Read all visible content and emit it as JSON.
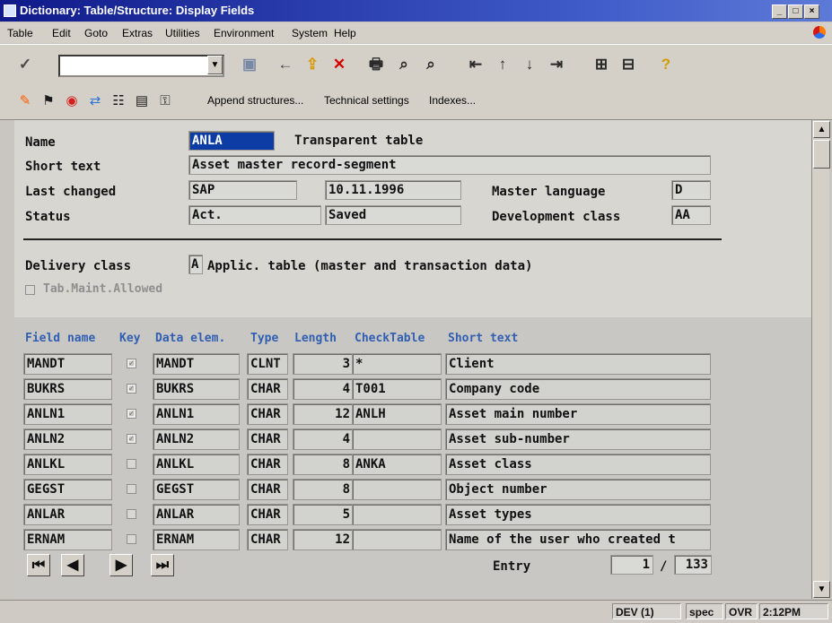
{
  "window": {
    "title": "Dictionary: Table/Structure: Display Fields",
    "controls": [
      "_",
      "□",
      "×"
    ]
  },
  "menu": [
    "Table",
    "Edit",
    "Goto",
    "Extras",
    "Utilities",
    "Environment",
    "System",
    "Help"
  ],
  "toolbar1": {
    "command_value": "",
    "icons": [
      "check-icon",
      "save-icon",
      "back-icon",
      "exit-icon",
      "cancel-icon",
      "print-icon",
      "find-icon",
      "find-next-icon",
      "first-page-icon",
      "previous-page-icon",
      "next-page-icon",
      "last-page-icon",
      "create-session-icon",
      "shortcut-icon",
      "help-icon"
    ]
  },
  "toolbar2": {
    "buttons": [
      "Append structures...",
      "Technical settings",
      "Indexes..."
    ]
  },
  "header": {
    "name_label": "Name",
    "name_value": "ANLA",
    "table_type": "Transparent table",
    "short_text_label": "Short text",
    "short_text_value": "Asset master record-segment",
    "last_changed_label": "Last changed",
    "last_changed_user": "SAP",
    "last_changed_date": "10.11.1996",
    "master_language_label": "Master language",
    "master_language_value": "D",
    "status_label": "Status",
    "status_value_1": "Act.",
    "status_value_2": "Saved",
    "development_class_label": "Development class",
    "development_class_value": "AA"
  },
  "delivery": {
    "label": "Delivery class",
    "code": "A",
    "text": "Applic. table (master and transaction data)",
    "tab_maint_label": "Tab.Maint.Allowed",
    "tab_maint_checked": false
  },
  "table": {
    "headers": [
      "Field name",
      "Key",
      "Data elem.",
      "Type",
      "Length",
      "CheckTable",
      "Short text"
    ],
    "rows": [
      {
        "field": "MANDT",
        "key": true,
        "data_elem": "MANDT",
        "type": "CLNT",
        "length": "3",
        "checktable": "*",
        "short_text": "Client"
      },
      {
        "field": "BUKRS",
        "key": true,
        "data_elem": "BUKRS",
        "type": "CHAR",
        "length": "4",
        "checktable": "T001",
        "short_text": "Company code"
      },
      {
        "field": "ANLN1",
        "key": true,
        "data_elem": "ANLN1",
        "type": "CHAR",
        "length": "12",
        "checktable": "ANLH",
        "short_text": "Asset main number"
      },
      {
        "field": "ANLN2",
        "key": true,
        "data_elem": "ANLN2",
        "type": "CHAR",
        "length": "4",
        "checktable": "",
        "short_text": "Asset sub-number"
      },
      {
        "field": "ANLKL",
        "key": false,
        "data_elem": "ANLKL",
        "type": "CHAR",
        "length": "8",
        "checktable": "ANKA",
        "short_text": "Asset class"
      },
      {
        "field": "GEGST",
        "key": false,
        "data_elem": "GEGST",
        "type": "CHAR",
        "length": "8",
        "checktable": "",
        "short_text": "Object number"
      },
      {
        "field": "ANLAR",
        "key": false,
        "data_elem": "ANLAR",
        "type": "CHAR",
        "length": "5",
        "checktable": "",
        "short_text": "Asset types"
      },
      {
        "field": "ERNAM",
        "key": false,
        "data_elem": "ERNAM",
        "type": "CHAR",
        "length": "12",
        "checktable": "",
        "short_text": "Name of the user who created t"
      }
    ]
  },
  "pagination": {
    "entry_label": "Entry",
    "current": "1",
    "separator": "/",
    "total": "133",
    "buttons": [
      "⏮",
      "◀",
      "▶",
      "⏭"
    ]
  },
  "status_bar": {
    "system": "DEV (1)",
    "host": "spec",
    "mode": "OVR",
    "time": "2:12PM"
  }
}
